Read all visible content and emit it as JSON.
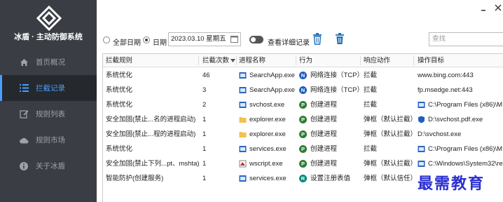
{
  "app": {
    "title": "冰盾 · 主动防御系统"
  },
  "sidebar": {
    "items": [
      {
        "label": "首页概况",
        "icon": "home-icon"
      },
      {
        "label": "拦截记录",
        "icon": "list-icon",
        "active": true
      },
      {
        "label": "规则列表",
        "icon": "edit-icon"
      },
      {
        "label": "规则市场",
        "icon": "cloud-icon"
      },
      {
        "label": "关于冰盾",
        "icon": "info-icon"
      }
    ]
  },
  "toolbar": {
    "all_dates_label": "全部日期",
    "date_label": "日期",
    "date_value": "2023.03.10 星期五",
    "show_details_label": "查看详细记录",
    "search_placeholder": "查找"
  },
  "table": {
    "headers": [
      "拦截规则",
      "拦截次数",
      "进程名称",
      "行为",
      "响应动作",
      "操作目标"
    ],
    "rows": [
      {
        "rule": "系统优化",
        "count": "46",
        "process": "SearchApp.exe",
        "behavior": "网络连接（TCP）",
        "behavior_badge": "N",
        "action": "拦截",
        "target": "www.bing.com:443"
      },
      {
        "rule": "系统优化",
        "count": "3",
        "process": "SearchApp.exe",
        "behavior": "网络连接（TCP）",
        "behavior_badge": "N",
        "action": "拦截",
        "target": "fp.msedge.net:443"
      },
      {
        "rule": "系统优化",
        "count": "2",
        "process": "svchost.exe",
        "behavior": "创建进程",
        "behavior_badge": "P",
        "action": "拦截",
        "target": "C:\\Program Files (x86)\\M"
      },
      {
        "rule": "安全加固(禁止...名的进程启动)",
        "count": "1",
        "process": "explorer.exe",
        "behavior": "创建进程",
        "behavior_badge": "P",
        "action": "弹框（默认拦截）",
        "target": "D:\\svchost.pdf.exe"
      },
      {
        "rule": "安全加固(禁止...程的进程启动)",
        "count": "1",
        "process": "explorer.exe",
        "behavior": "创建进程",
        "behavior_badge": "P",
        "action": "弹框（默认拦截）",
        "target": "D:\\svchost.exe"
      },
      {
        "rule": "系统优化",
        "count": "1",
        "process": "services.exe",
        "behavior": "创建进程",
        "behavior_badge": "P",
        "action": "拦截",
        "target": "C:\\Program Files (x86)\\M"
      },
      {
        "rule": "安全加固(禁止下列...pt、mshta)",
        "count": "1",
        "process": "wscript.exe",
        "behavior": "创建进程",
        "behavior_badge": "P",
        "action": "弹框（默认拦截）",
        "target": "C:\\Windows\\System32\\re"
      },
      {
        "rule": "智能防护(创建服务)",
        "count": "1",
        "process": "services.exe",
        "behavior": "设置注册表值",
        "behavior_badge": "R",
        "action": "弹框（默认信任）",
        "target": ""
      }
    ]
  },
  "watermark": "最需教育",
  "colors": {
    "sidebar_bg": "#3a3d43",
    "accent": "#4a9eff",
    "badge_network": "#1f5fbf",
    "badge_process": "#2e7d32",
    "badge_registry": "#00897b"
  }
}
